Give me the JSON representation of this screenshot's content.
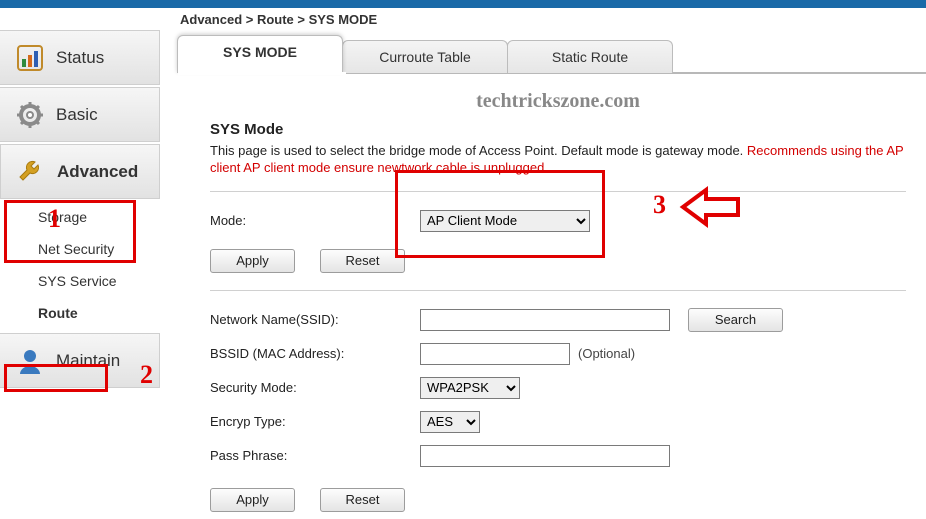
{
  "breadcrumb": "Advanced > Route > SYS MODE",
  "watermark": "techtrickszone.com",
  "sidebar": {
    "status": "Status",
    "basic": "Basic",
    "advanced": "Advanced",
    "storage": "Storage",
    "netsecurity": "Net Security",
    "sysservice": "SYS Service",
    "route": "Route",
    "maintain": "Maintain"
  },
  "tabs": {
    "sysmode": "SYS MODE",
    "curroute": "Curroute Table",
    "static": "Static Route"
  },
  "section": {
    "title": "SYS Mode",
    "desc_plain": "This page is used to select the bridge mode of Access Point. Default mode is gateway mode. ",
    "desc_warn": "Recommends using the AP client AP client mode ensure newtwork cable is unplugged"
  },
  "form": {
    "mode_label": "Mode:",
    "mode_value": "AP Client Mode",
    "apply": "Apply",
    "reset": "Reset",
    "ssid_label": "Network Name(SSID):",
    "ssid_value": "",
    "search": "Search",
    "bssid_label": "BSSID (MAC Address):",
    "bssid_value": "",
    "optional": "(Optional)",
    "secmode_label": "Security Mode:",
    "secmode_value": "WPA2PSK",
    "encryp_label": "Encryp Type:",
    "encryp_value": "AES",
    "pass_label": "Pass Phrase:",
    "pass_value": ""
  },
  "annotations": {
    "n1": "1",
    "n2": "2",
    "n3": "3"
  }
}
